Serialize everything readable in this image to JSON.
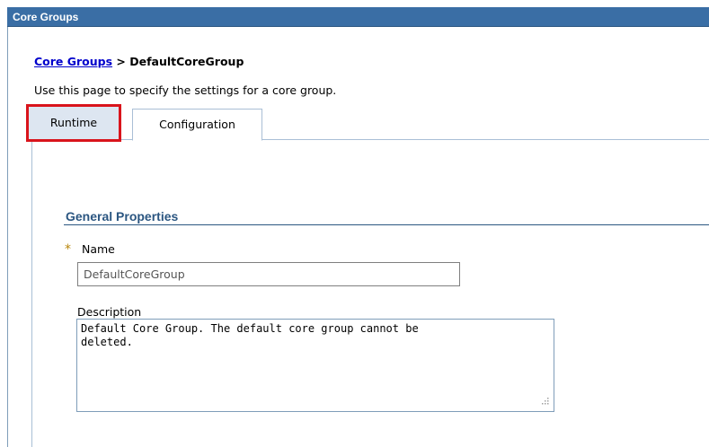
{
  "window": {
    "title": "Core Groups"
  },
  "breadcrumb": {
    "link": "Core Groups",
    "separator": " > ",
    "current": "DefaultCoreGroup"
  },
  "intro_text": "Use this page to specify the settings for a core group.",
  "tabs": [
    {
      "label": "Runtime",
      "highlighted": true
    },
    {
      "label": "Configuration",
      "active": true
    }
  ],
  "general_properties": {
    "title": "General Properties",
    "name": {
      "required_marker": "*",
      "label": "Name",
      "value": "DefaultCoreGroup"
    },
    "description": {
      "label": "Description",
      "value": "Default Core Group. The default core group cannot be\ndeleted."
    }
  },
  "colors": {
    "titlebar": "#3a6ea5",
    "link": "#0000cc",
    "section_title": "#2b5681",
    "highlight_box": "#d9141c",
    "tab_border": "#a9bfd6"
  }
}
